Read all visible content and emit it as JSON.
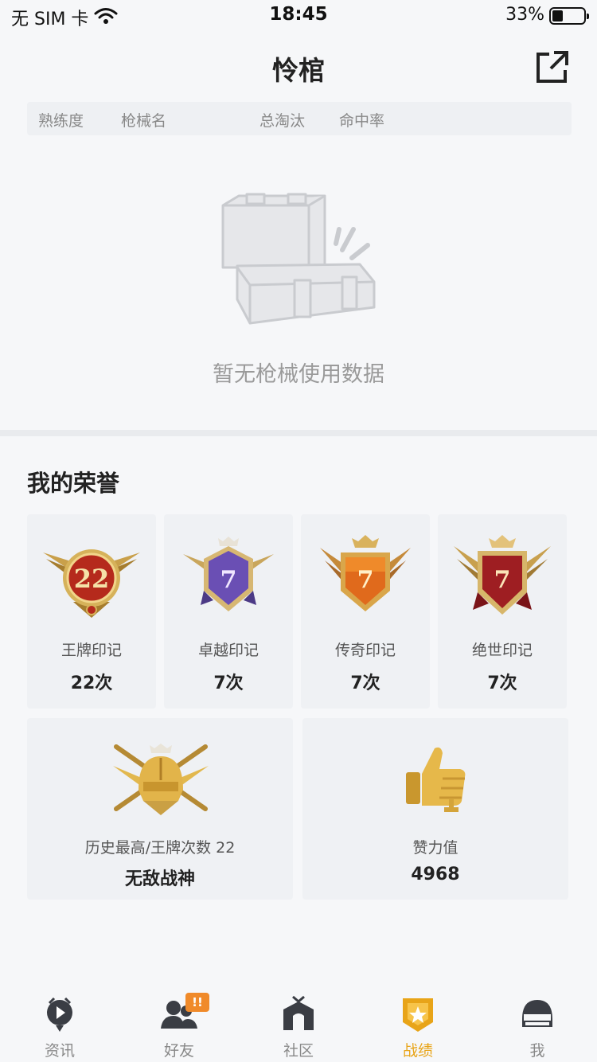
{
  "status_bar": {
    "carrier": "无 SIM 卡",
    "time": "18:45",
    "battery_pct": "33%",
    "battery_level": 0.33
  },
  "header": {
    "title": "怜棺",
    "share_icon": "share-external-icon"
  },
  "weapon_table": {
    "columns": [
      "熟练度",
      "枪械名",
      "总淘汰",
      "命中率"
    ]
  },
  "empty_state": {
    "icon": "empty-chest-icon",
    "text": "暂无枪械使用数据"
  },
  "honors": {
    "title": "我的荣誉",
    "marks": [
      {
        "icon": "ace-mark-badge-icon",
        "badge_number": "22",
        "label": "王牌印记",
        "count": "22次"
      },
      {
        "icon": "elite-mark-badge-icon",
        "badge_number": "7",
        "label": "卓越印记",
        "count": "7次"
      },
      {
        "icon": "legend-mark-badge-icon",
        "badge_number": "7",
        "label": "传奇印记",
        "count": "7次"
      },
      {
        "icon": "peerless-mark-badge-icon",
        "badge_number": "7",
        "label": "绝世印记",
        "count": "7次"
      }
    ],
    "highest": {
      "icon": "helmet-emblem-icon",
      "label": "历史最高/王牌次数 22",
      "value": "无敌战神"
    },
    "likes": {
      "icon": "thumbs-up-trophy-icon",
      "label": "赞力值",
      "value": "4968"
    }
  },
  "nav": {
    "items": [
      {
        "label": "资讯",
        "icon": "news-play-icon"
      },
      {
        "label": "好友",
        "icon": "friends-icon"
      },
      {
        "label": "社区",
        "icon": "community-house-icon"
      },
      {
        "label": "战绩",
        "icon": "record-badge-icon"
      },
      {
        "label": "我",
        "icon": "helmet-icon"
      }
    ],
    "active_index": 3,
    "friends_badge": "!!"
  },
  "colors": {
    "accent": "#e8a418",
    "badge": "#f08a2a",
    "background": "#f6f7f9",
    "card": "#eff1f4"
  }
}
